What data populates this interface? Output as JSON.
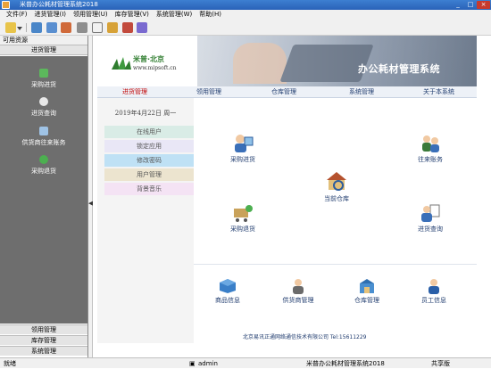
{
  "window": {
    "title": "米普办公耗材管理系统2018",
    "controls": [
      "_",
      "□",
      "×"
    ]
  },
  "menu": [
    {
      "label": "文件(F)"
    },
    {
      "label": "进货管理(I)"
    },
    {
      "label": "领用管理(U)"
    },
    {
      "label": "库存管理(V)"
    },
    {
      "label": "系统管理(W)"
    },
    {
      "label": "帮助(H)"
    }
  ],
  "toolbar": {
    "buttons": [
      "new-icon",
      "dropdown-icon",
      "grid-icon",
      "cube-icon",
      "home-icon",
      "print-icon",
      "notepad-icon",
      "lock-icon",
      "user-icon",
      "exit-icon"
    ]
  },
  "sidebar": {
    "title": "可用资源",
    "active_section": "进货管理",
    "items": [
      {
        "label": "采购进货",
        "icon": "purchase-icon"
      },
      {
        "label": "进货查询",
        "icon": "search-icon"
      },
      {
        "label": "供货商往来账务",
        "icon": "ledger-icon"
      },
      {
        "label": "采购退货",
        "icon": "return-icon"
      }
    ],
    "sections": [
      "领用管理",
      "库存管理",
      "系统管理"
    ]
  },
  "banner": {
    "logo_name": "米普·北京",
    "logo_url": "www.mipsoft.cn",
    "title": "办公耗材管理系统"
  },
  "nav": {
    "items": [
      "进货管理",
      "领用管理",
      "仓库管理",
      "系统管理",
      "关于本系统"
    ],
    "active": "进货管理"
  },
  "quick": {
    "date": "2019年4月22日  周一",
    "buttons": [
      {
        "label": "在线用户",
        "color": "#d9ece6"
      },
      {
        "label": "锁定应用",
        "color": "#e9e7f6"
      },
      {
        "label": "修改密码",
        "color": "#bfe1f5"
      },
      {
        "label": "用户管理",
        "color": "#ece4cf"
      },
      {
        "label": "背景音乐",
        "color": "#f4e3f4"
      }
    ]
  },
  "functions": {
    "purchase": "采购进货",
    "dealings": "往来账务",
    "warehouse": "当前仓库",
    "return": "采购退货",
    "query": "进货查询"
  },
  "bottom_functions": [
    "商品信息",
    "供货商管理",
    "仓库管理",
    "员工信息"
  ],
  "footer": "北京易讯正通网络通信技术有限公司  Tel:15611229",
  "status": {
    "ready": "就绪",
    "user": "admin",
    "app": "米普办公耗材管理系统2018",
    "edition": "共享版"
  },
  "colors": {
    "titlebar": "#2a62b8",
    "sidebar_panel": "#6e6e6e",
    "active_nav": "#c00000",
    "nav_text": "#1f3b6e",
    "logo_green": "#2f7d2f"
  }
}
